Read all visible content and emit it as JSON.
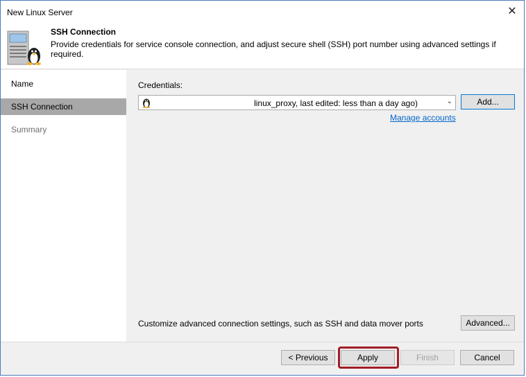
{
  "window": {
    "title": "New Linux Server",
    "close_glyph": "✕"
  },
  "header": {
    "title": "SSH Connection",
    "description": "Provide credentials for service console connection, and adjust secure shell (SSH) port number using advanced settings if required.",
    "icon": "linux-server-icon"
  },
  "sidebar": {
    "steps": [
      {
        "label": "Name",
        "state": "done"
      },
      {
        "label": "SSH Connection",
        "state": "active"
      },
      {
        "label": "Summary",
        "state": "pending"
      }
    ]
  },
  "main": {
    "credentials_label": "Credentials:",
    "credentials_value": "linux_proxy, last edited: less than a day ago)",
    "credentials_icon": "tux-icon",
    "add_button": "Add...",
    "manage_accounts_link": "Manage accounts",
    "advanced_text": "Customize advanced connection settings, such as SSH and data mover ports",
    "advanced_button": "Advanced..."
  },
  "footer": {
    "previous_button": "< Previous",
    "apply_button": "Apply",
    "finish_button": "Finish",
    "cancel_button": "Cancel"
  },
  "colors": {
    "window_border": "#4a7bbd",
    "active_step_bg": "#a8a8a8",
    "link": "#0066cc",
    "highlight": "#a01d26",
    "focus_blue": "#0078d7"
  }
}
